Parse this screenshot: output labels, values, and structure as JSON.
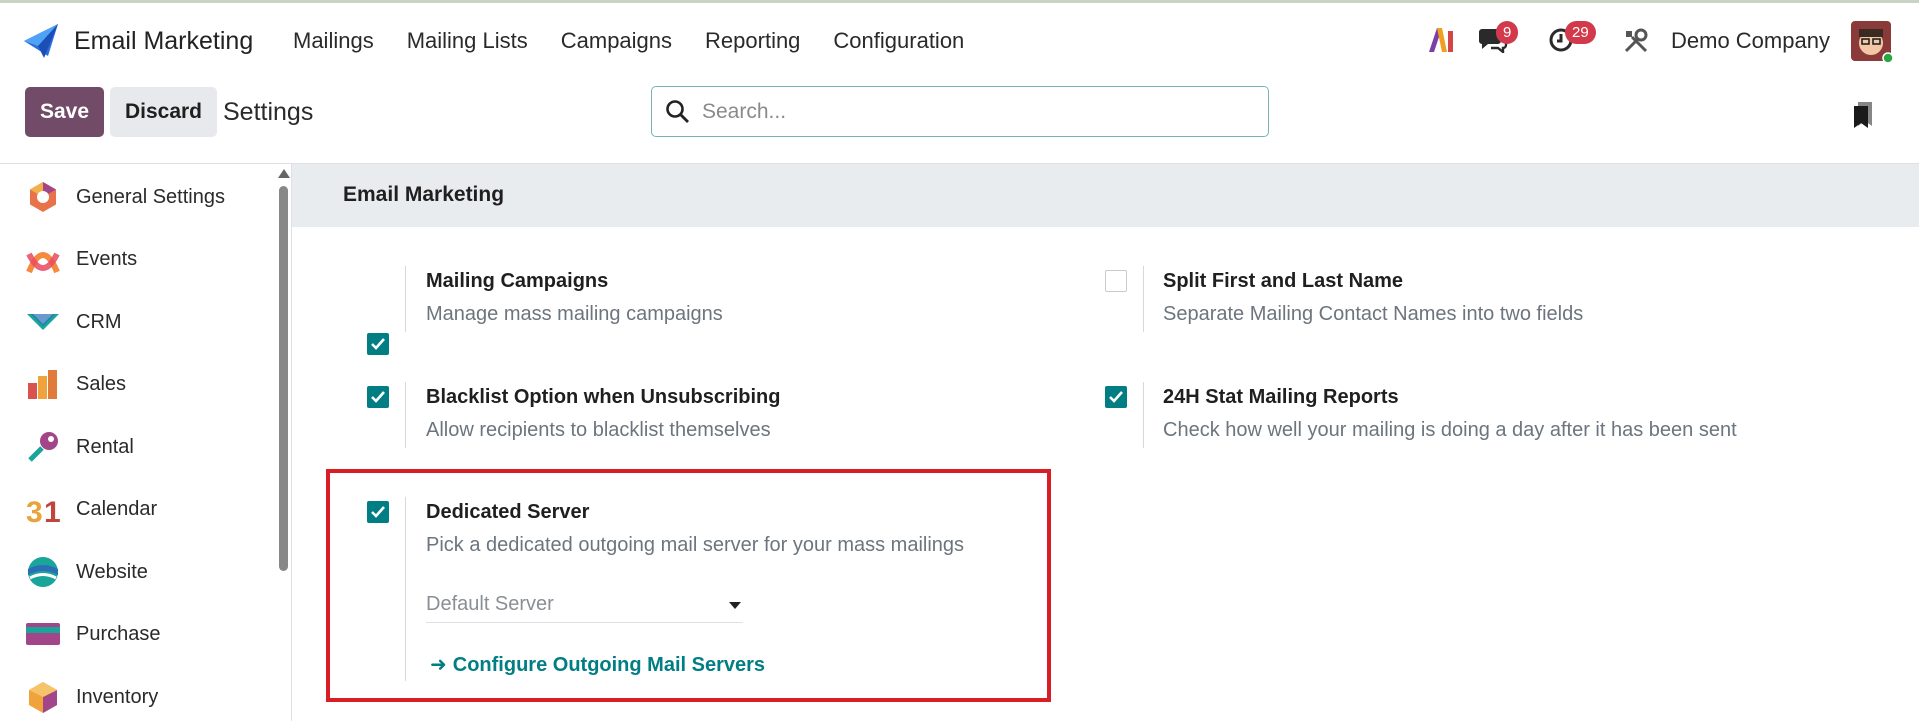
{
  "app": {
    "name": "Email Marketing",
    "menu": [
      "Mailings",
      "Mailing Lists",
      "Campaigns",
      "Reporting",
      "Configuration"
    ]
  },
  "systray": {
    "messages_count": "9",
    "activities_count": "29",
    "company": "Demo Company"
  },
  "control_panel": {
    "save_label": "Save",
    "discard_label": "Discard",
    "title": "Settings",
    "search_placeholder": "Search..."
  },
  "sidebar": {
    "items": [
      {
        "label": "General Settings",
        "icon": "general-settings-icon"
      },
      {
        "label": "Events",
        "icon": "events-icon"
      },
      {
        "label": "CRM",
        "icon": "crm-icon"
      },
      {
        "label": "Sales",
        "icon": "sales-icon"
      },
      {
        "label": "Rental",
        "icon": "rental-icon"
      },
      {
        "label": "Calendar",
        "icon": "calendar-icon"
      },
      {
        "label": "Website",
        "icon": "website-icon"
      },
      {
        "label": "Purchase",
        "icon": "purchase-icon"
      },
      {
        "label": "Inventory",
        "icon": "inventory-icon"
      }
    ]
  },
  "section": {
    "title": "Email Marketing",
    "settings": [
      {
        "title": "Mailing Campaigns",
        "description": "Manage mass mailing campaigns",
        "checked": true
      },
      {
        "title": "Split First and Last Name",
        "description": "Separate Mailing Contact Names into two fields",
        "checked": false
      },
      {
        "title": "Blacklist Option when Unsubscribing",
        "description": "Allow recipients to blacklist themselves",
        "checked": true
      },
      {
        "title": "24H Stat Mailing Reports",
        "description": "Check how well your mailing is doing a day after it has been sent",
        "checked": true
      },
      {
        "title": "Dedicated Server",
        "description": "Pick a dedicated outgoing mail server for your mass mailings",
        "checked": true,
        "select_value": "Default Server",
        "link_label": "Configure Outgoing Mail Servers"
      }
    ]
  },
  "colors": {
    "primary": "#714b67",
    "accent": "#017e84",
    "highlight": "#d81f28",
    "badge": "#d23a4c"
  }
}
